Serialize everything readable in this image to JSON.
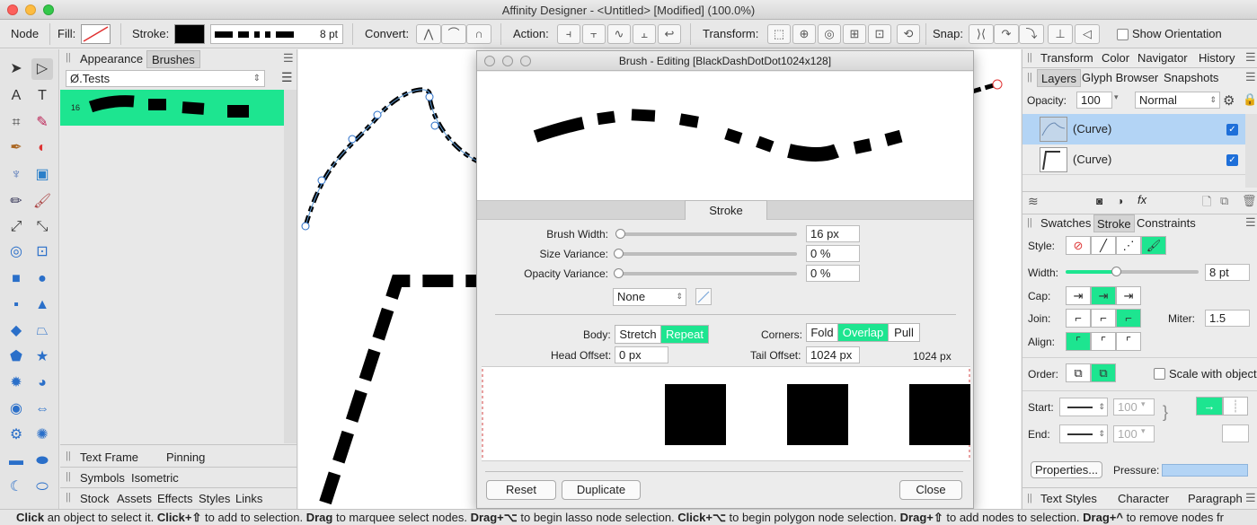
{
  "window": {
    "title": "Affinity Designer - <Untitled> [Modified] (100.0%)"
  },
  "toolbar": {
    "persona": "Node",
    "fill_label": "Fill:",
    "stroke_label": "Stroke:",
    "stroke_size": "8 pt",
    "convert_label": "Convert:",
    "action_label": "Action:",
    "transform_label": "Transform:",
    "snap_label": "Snap:",
    "show_orientation": "Show Orientation"
  },
  "left_panel": {
    "tabs": [
      "Appearance",
      "Brushes"
    ],
    "category": "Ø.Tests",
    "brush_item_size": "16",
    "bottom_tabs": [
      [
        "Text Frame",
        "Pinning"
      ],
      [
        "Symbols",
        "Isometric"
      ],
      [
        "Stock",
        "Assets",
        "Effects",
        "Styles",
        "Links"
      ]
    ]
  },
  "dialog": {
    "title": "Brush - Editing [BlackDashDotDot1024x128]",
    "tab": "Stroke",
    "brush_width_label": "Brush Width:",
    "brush_width_value": "16 px",
    "brush_width_fraction": 0.0,
    "size_variance_label": "Size Variance:",
    "size_variance_value": "0 %",
    "opacity_variance_label": "Opacity Variance:",
    "opacity_variance_value": "0 %",
    "pressure_select": "None",
    "body_label": "Body:",
    "body_options": [
      "Stretch",
      "Repeat"
    ],
    "body_selected": "Repeat",
    "corners_label": "Corners:",
    "corner_options": [
      "Fold",
      "Overlap",
      "Pull"
    ],
    "corner_selected": "Overlap",
    "head_offset_label": "Head Offset:",
    "head_offset_value": "0 px",
    "tail_offset_label": "Tail Offset:",
    "tail_offset_value": "1024 px",
    "texture_width": "1024 px",
    "buttons": {
      "reset": "Reset",
      "duplicate": "Duplicate",
      "close": "Close"
    }
  },
  "right_panel": {
    "top_tabs": [
      "Transform",
      "Color",
      "Navigator",
      "History"
    ],
    "layer_tabs": [
      "Layers",
      "Glyph Browser",
      "Snapshots"
    ],
    "opacity_label": "Opacity:",
    "opacity_value": "100",
    "blend_mode": "Normal",
    "layers": [
      "(Curve)",
      "(Curve)"
    ],
    "stroke_tabs": [
      "Swatches",
      "Stroke",
      "Constraints"
    ],
    "style_label": "Style:",
    "width_label": "Width:",
    "width_value": "8 pt",
    "cap_label": "Cap:",
    "join_label": "Join:",
    "miter_label": "Miter:",
    "miter_value": "1.5",
    "align_label": "Align:",
    "order_label": "Order:",
    "scale_with_object": "Scale with object",
    "start_label": "Start:",
    "start_value": "100",
    "end_label": "End:",
    "end_value": "100",
    "properties_button": "Properties...",
    "pressure_label": "Pressure:",
    "bottom_tabs": [
      "Text Styles",
      "Character",
      "Paragraph"
    ]
  },
  "status_bar": {
    "parts": [
      {
        "bold": "Click",
        "text": " an object to select it. "
      },
      {
        "bold": "Click+⇧",
        "text": " to add to selection. "
      },
      {
        "bold": "Drag",
        "text": " to marquee select nodes. "
      },
      {
        "bold": "Drag+⌥",
        "text": " to begin lasso node selection. "
      },
      {
        "bold": "Click+⌥",
        "text": " to begin polygon node selection. "
      },
      {
        "bold": "Drag+⇧",
        "text": " to add nodes to selection. "
      },
      {
        "bold": "Drag+^",
        "text": " to remove nodes fr"
      }
    ]
  },
  "colors": {
    "accent": "#1de590",
    "selection": "#b3d4f5",
    "stroke": "#000000"
  }
}
